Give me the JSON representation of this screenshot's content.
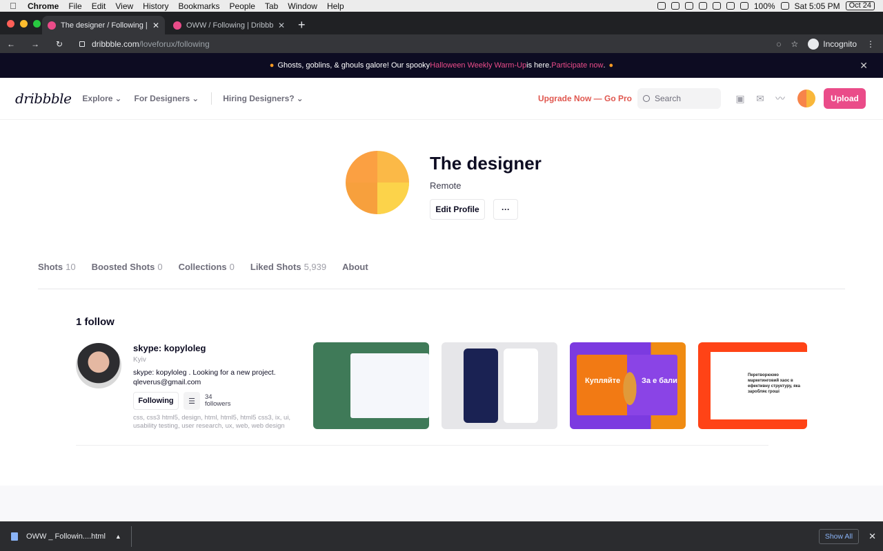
{
  "menubar": {
    "app": "Chrome",
    "items": [
      "File",
      "Edit",
      "View",
      "History",
      "Bookmarks",
      "People",
      "Tab",
      "Window",
      "Help"
    ],
    "battery": "100%",
    "time": "Sat 5:05 PM",
    "date": "Oct 24"
  },
  "tabs": [
    {
      "title": "The designer / Following | Dribbble",
      "active": true
    },
    {
      "title": "OWW / Following | Dribbble",
      "active": false
    }
  ],
  "address": {
    "host": "dribbble.com",
    "path": "/loveforux/following",
    "profile": "Incognito"
  },
  "banner": {
    "text_start": "Ghosts, goblins, & ghouls galore! Our spooky ",
    "link1": "Halloween Weekly Warm-Up",
    "text_mid": " is here. ",
    "link2": "Participate now",
    "text_end": "."
  },
  "nav": {
    "logo": "dribbble",
    "explore": "Explore",
    "for_designers": "For Designers",
    "hiring": "Hiring Designers?",
    "upgrade": "Upgrade Now — Go Pro",
    "search_placeholder": "Search",
    "upload": "Upload"
  },
  "profile": {
    "name": "The designer",
    "location": "Remote",
    "edit_label": "Edit Profile",
    "more_label": "···"
  },
  "profile_tabs": [
    {
      "label": "Shots",
      "count": "10"
    },
    {
      "label": "Boosted Shots",
      "count": "0"
    },
    {
      "label": "Collections",
      "count": "0"
    },
    {
      "label": "Liked Shots",
      "count": "5,939"
    },
    {
      "label": "About",
      "count": ""
    }
  ],
  "follow_section": {
    "title": "1 follow",
    "person": {
      "name": "skype: kopyloleg",
      "city": "Kyiv",
      "bio": "skype: kopyloleg . Looking for a new project. qleverus@gmail.com",
      "following_label": "Following",
      "followers_count": "34",
      "followers_label": "followers",
      "tags": "css, css3 html5, design, html, html5, html5 css3, ix, ui, usability testing, user research, ux, web, web design"
    },
    "shot3_text_left": "Купляйте",
    "shot3_text_right": "За е бали",
    "shot4_text": "Перетворюємо маркетинговий хаос в ефективну структуру, яка заробляє гроші"
  },
  "download_bar": {
    "filename": "OWW _ Followin....html",
    "show_all": "Show All"
  },
  "colors": {
    "brand_pink": "#ea4c89",
    "upgrade_red": "#e0574f",
    "banner_bg": "#0d0c22"
  }
}
